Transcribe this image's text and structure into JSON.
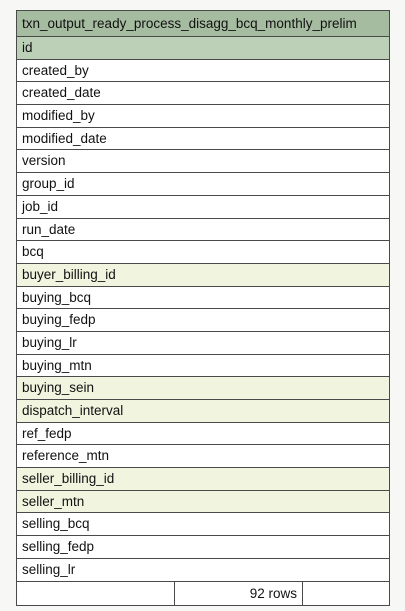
{
  "table": {
    "name": "txn_output_ready_process_disagg_bcq_monthly_prelim",
    "columns": [
      {
        "name": "id",
        "kind": "pk"
      },
      {
        "name": "created_by",
        "kind": "plain"
      },
      {
        "name": "created_date",
        "kind": "plain"
      },
      {
        "name": "modified_by",
        "kind": "plain"
      },
      {
        "name": "modified_date",
        "kind": "plain"
      },
      {
        "name": "version",
        "kind": "plain"
      },
      {
        "name": "group_id",
        "kind": "plain"
      },
      {
        "name": "job_id",
        "kind": "plain"
      },
      {
        "name": "run_date",
        "kind": "plain"
      },
      {
        "name": "bcq",
        "kind": "plain"
      },
      {
        "name": "buyer_billing_id",
        "kind": "fk"
      },
      {
        "name": "buying_bcq",
        "kind": "plain"
      },
      {
        "name": "buying_fedp",
        "kind": "plain"
      },
      {
        "name": "buying_lr",
        "kind": "plain"
      },
      {
        "name": "buying_mtn",
        "kind": "plain"
      },
      {
        "name": "buying_sein",
        "kind": "fk"
      },
      {
        "name": "dispatch_interval",
        "kind": "fk"
      },
      {
        "name": "ref_fedp",
        "kind": "plain"
      },
      {
        "name": "reference_mtn",
        "kind": "plain"
      },
      {
        "name": "seller_billing_id",
        "kind": "fk"
      },
      {
        "name": "seller_mtn",
        "kind": "fk"
      },
      {
        "name": "selling_bcq",
        "kind": "plain"
      },
      {
        "name": "selling_fedp",
        "kind": "plain"
      },
      {
        "name": "selling_lr",
        "kind": "plain"
      }
    ],
    "row_count_label": "92 rows"
  },
  "colors": {
    "header": "#a6bca0",
    "primary_key": "#bcd0b8",
    "foreign_key": "#f1f4de",
    "border": "#4a4a4a"
  }
}
